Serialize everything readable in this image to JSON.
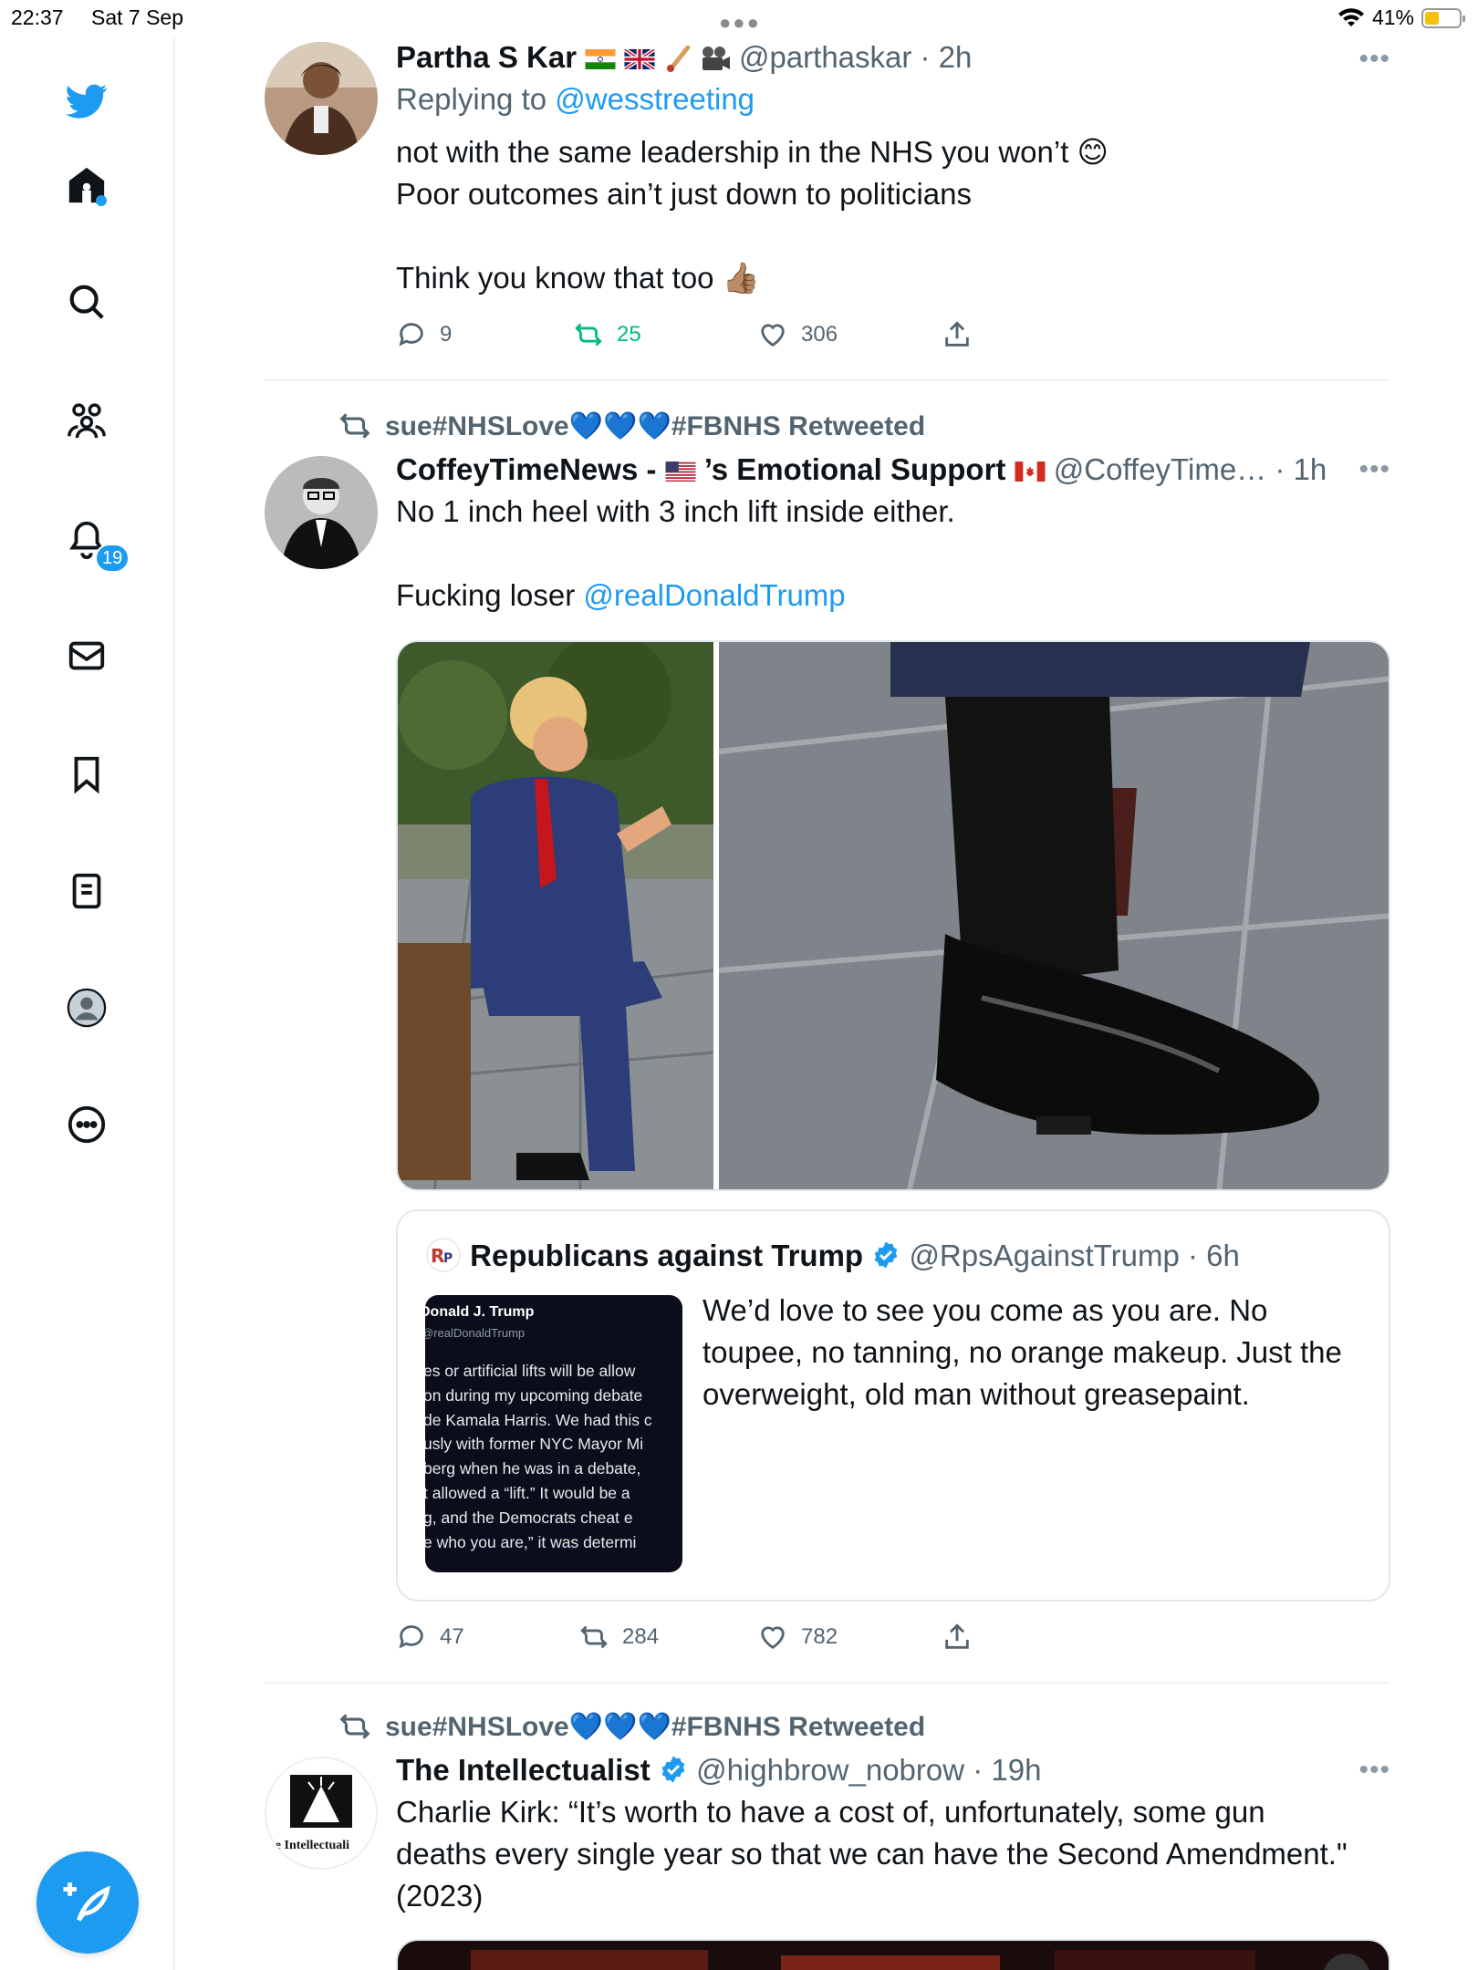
{
  "status_bar": {
    "time": "22:37",
    "date": "Sat 7 Sep",
    "battery": "41%",
    "battery_level": 0.41
  },
  "sidebar": {
    "notifications_count": "19"
  },
  "tweets": [
    {
      "name": "Partha S Kar",
      "handle": "@parthaskar",
      "time": "2h",
      "reply_label": "Replying to",
      "reply_handle": "@wesstreeting",
      "lines": [
        "not with the same leadership in the NHS you won’t 😊",
        "Poor outcomes ain’t just down to politicians",
        "",
        "Think you know that too 👍🏽"
      ],
      "replies": "9",
      "retweets": "25",
      "likes": "306"
    },
    {
      "retweeted_by": "sue#NHSLove💙💙💙#FBNHS Retweeted",
      "name_prefix": "CoffeyTimeNews - ",
      "name_suffix": "’s Emotional Support",
      "handle": "@CoffeyTime…",
      "time": "1h",
      "line1": "No 1 inch heel with 3 inch lift inside either.",
      "line2_text": "Fucking loser ",
      "line2_mention": "@realDonaldTrump",
      "quote": {
        "name": "Republicans against Trump",
        "handle": "@RpsAgainstTrump",
        "time": "6h",
        "text": "We’d love to see you come as you are. No toupee, no tanning, no orange makeup. Just the overweight, old man without greasepaint.",
        "thumb_name": "Donald J. Trump",
        "thumb_handle": "@realDonaldTrump",
        "thumb_lines": [
          "es or artificial lifts will be allow",
          "on during my upcoming debate",
          "de Kamala Harris. We had this c",
          "usly with former NYC Mayor Mi",
          "berg when he was in a debate,",
          "t allowed a “lift.” It would be a",
          "g, and the Democrats cheat e",
          "e who you are,” it was determi"
        ]
      },
      "replies": "47",
      "retweets": "284",
      "likes": "782"
    },
    {
      "retweeted_by": "sue#NHSLove💙💙💙#FBNHS Retweeted",
      "name": "The Intellectualist",
      "handle": "@highbrow_nobrow",
      "time": "19h",
      "avatar_text": "he Intellectuali",
      "lines": [
        "Charlie Kirk: “It’s worth to have a cost of, unfortunately, some gun",
        "deaths every single year so that we can have the Second Amendment.\"",
        "(2023)"
      ]
    }
  ]
}
